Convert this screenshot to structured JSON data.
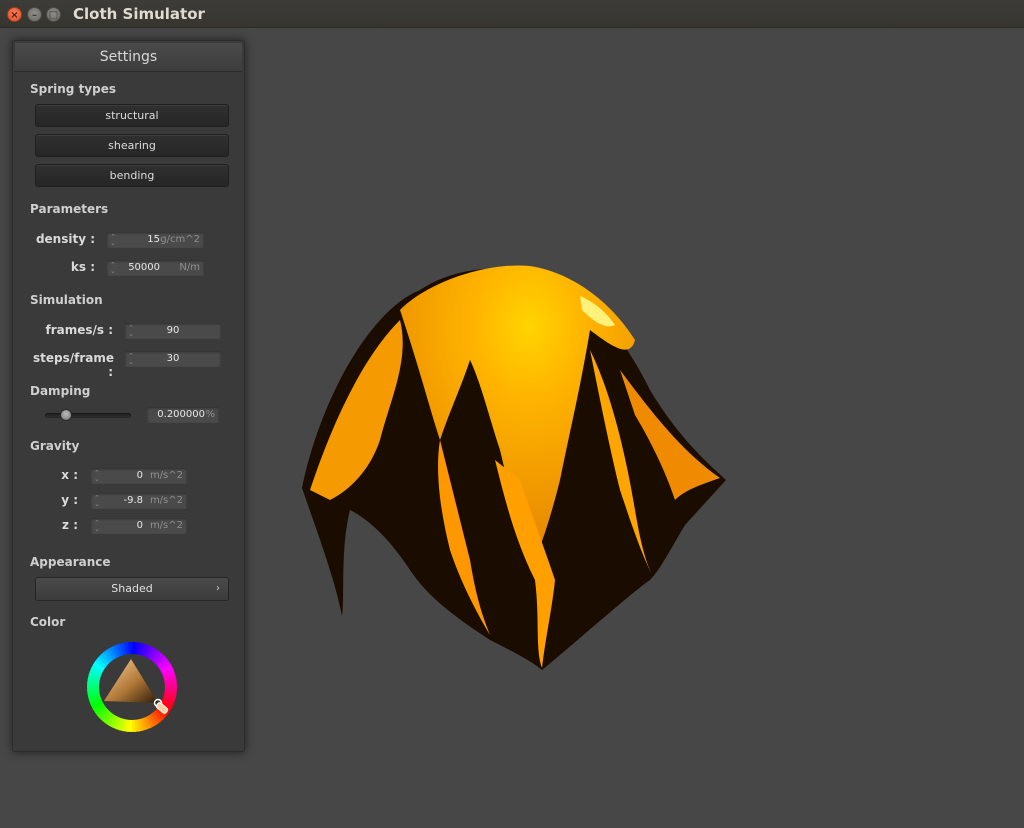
{
  "window": {
    "title": "Cloth Simulator",
    "buttons": {
      "close": "×",
      "minimize": "–",
      "maximize": "□"
    }
  },
  "panel": {
    "title": "Settings",
    "spring_types": {
      "heading": "Spring types",
      "buttons": [
        "structural",
        "shearing",
        "bending"
      ]
    },
    "parameters": {
      "heading": "Parameters",
      "density": {
        "label": "density :",
        "value": "15",
        "unit": "g/cm^2"
      },
      "ks": {
        "label": "ks :",
        "value": "50000",
        "unit": "N/m"
      }
    },
    "simulation": {
      "heading": "Simulation",
      "fps": {
        "label": "frames/s :",
        "value": "90"
      },
      "steps": {
        "label": "steps/frame :",
        "value": "30"
      }
    },
    "damping": {
      "heading": "Damping",
      "value": "0.200000",
      "unit": "%",
      "slider_fraction": 0.2
    },
    "gravity": {
      "heading": "Gravity",
      "x": {
        "label": "x :",
        "value": "0",
        "unit": "m/s^2"
      },
      "y": {
        "label": "y :",
        "value": "-9.8",
        "unit": "m/s^2"
      },
      "z": {
        "label": "z :",
        "value": "0",
        "unit": "m/s^2"
      }
    },
    "appearance": {
      "heading": "Appearance",
      "selected": "Shaded",
      "chevron": "›"
    },
    "color": {
      "heading": "Color",
      "selected_color": "#f5a623"
    }
  },
  "colors": {
    "cloth_bright": "#ffb400",
    "cloth_mid": "#f19000",
    "cloth_dark": "#1a0d00"
  }
}
